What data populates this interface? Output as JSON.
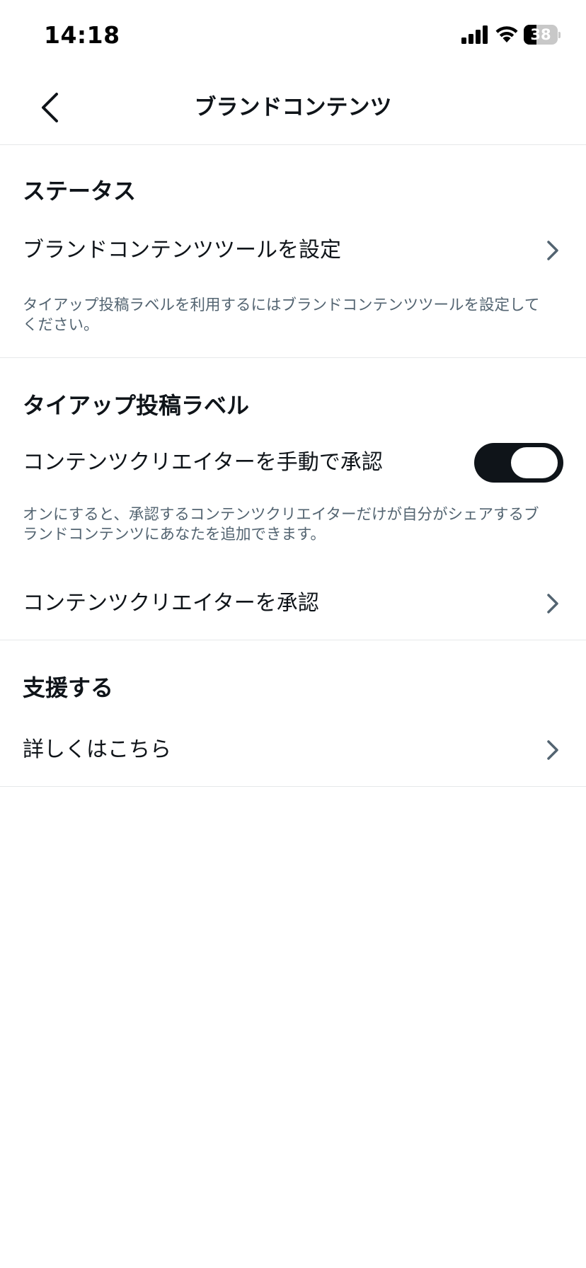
{
  "status_bar": {
    "time": "14:18",
    "battery_level": "38",
    "battery_fraction": 0.38
  },
  "header": {
    "title": "ブランドコンテンツ",
    "back_icon": "chevron-left-icon"
  },
  "sections": {
    "status": {
      "heading": "ステータス",
      "row_label": "ブランドコンテンツツールを設定",
      "description": "タイアップ投稿ラベルを利用するにはブランドコンテンツツールを設定してください。"
    },
    "paid_partnership": {
      "heading": "タイアップ投稿ラベル",
      "toggle_label": "コンテンツクリエイターを手動で承認",
      "toggle_on": true,
      "description": "オンにすると、承認するコンテンツクリエイターだけが自分がシェアするブランドコンテンツにあなたを追加できます。",
      "row_label": "コンテンツクリエイターを承認"
    },
    "support": {
      "heading": "支援する",
      "row_label": "詳しくはこちら"
    }
  },
  "colors": {
    "text_primary": "#0f1419",
    "text_secondary": "#536471",
    "divider": "#e6e8ea",
    "toggle_on": "#0f1419"
  }
}
